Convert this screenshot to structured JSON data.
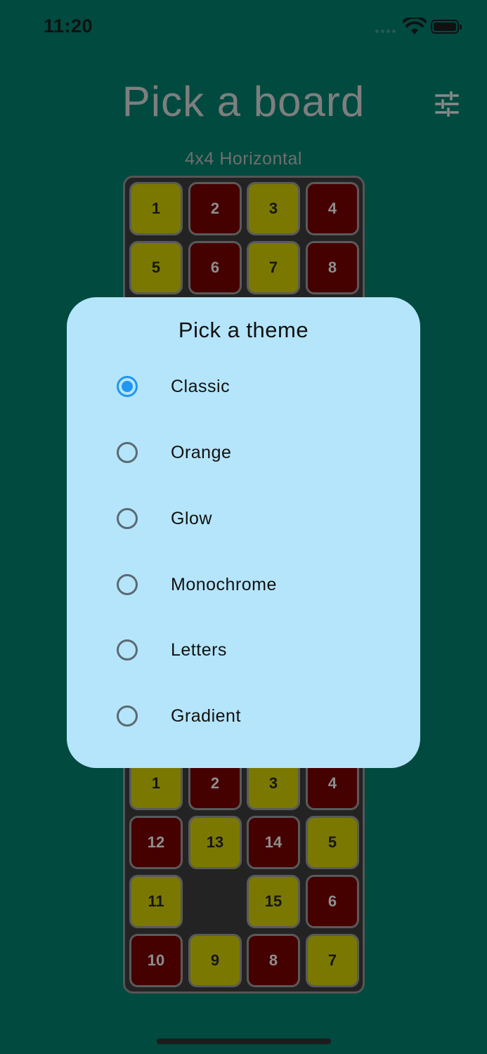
{
  "status_bar": {
    "time": "11:20"
  },
  "header": {
    "title": "Pick a board",
    "settings_icon": "sliders-icon"
  },
  "board_preview": {
    "label": "4x4 Horizontal",
    "visible_tiles": [
      "1",
      "2",
      "3",
      "4",
      "5",
      "6",
      "7",
      "8"
    ]
  },
  "board_preview_2": {
    "tiles": [
      "1",
      "2",
      "3",
      "4",
      "12",
      "13",
      "14",
      "5",
      "11",
      "",
      "15",
      "6",
      "10",
      "9",
      "8",
      "7"
    ]
  },
  "theme_dialog": {
    "title": "Pick a theme",
    "selected": "Classic",
    "options": [
      {
        "label": "Classic",
        "selected": true
      },
      {
        "label": "Orange",
        "selected": false
      },
      {
        "label": "Glow",
        "selected": false
      },
      {
        "label": "Monochrome",
        "selected": false
      },
      {
        "label": "Letters",
        "selected": false
      },
      {
        "label": "Gradient",
        "selected": false
      }
    ]
  },
  "colors": {
    "background": "#004a40",
    "dialog_background": "#b5e5fa",
    "radio_selected": "#2196f3",
    "tile_yellow": "#7a7800",
    "tile_red": "#450000"
  }
}
